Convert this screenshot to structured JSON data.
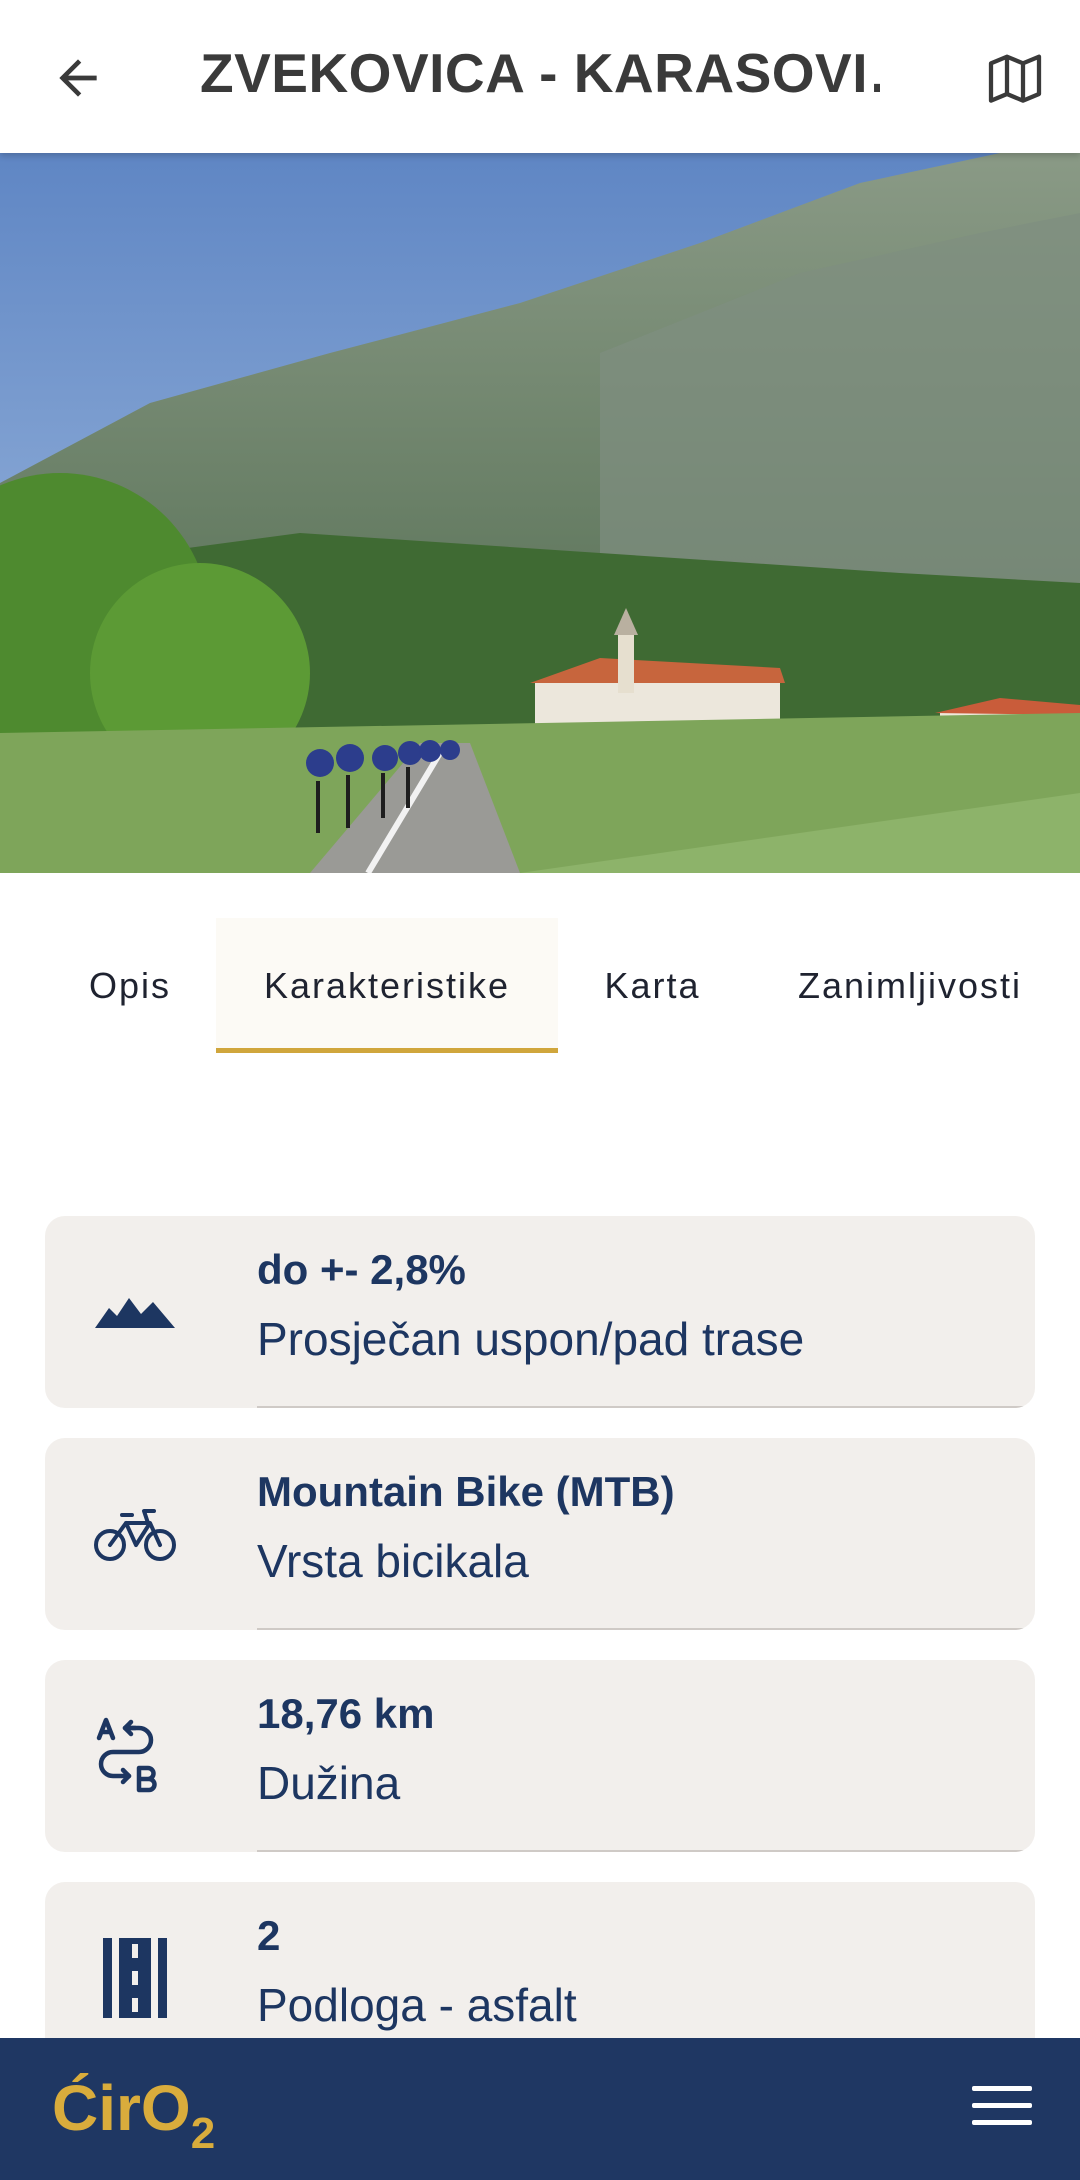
{
  "header": {
    "title": "ZVEKOVICA - KARASOVI…",
    "back_icon": "arrow-left-icon",
    "map_icon": "map-icon"
  },
  "tabs": [
    {
      "label": "Opis",
      "active": false
    },
    {
      "label": "Karakteristike",
      "active": true
    },
    {
      "label": "Karta",
      "active": false
    },
    {
      "label": "Zanimljivosti",
      "active": false
    }
  ],
  "characteristics": [
    {
      "icon": "mountains-icon",
      "value": "do +- 2,8%",
      "label": "Prosječan uspon/pad trase"
    },
    {
      "icon": "bicycle-icon",
      "value": "Mountain Bike (MTB)",
      "label": "Vrsta bicikala"
    },
    {
      "icon": "route-a-to-b-icon",
      "value": "18,76 km",
      "label": "Dužina"
    },
    {
      "icon": "road-icon",
      "value": "2",
      "label": "Podloga - asfalt"
    }
  ],
  "bottom_bar": {
    "logo_text": "ĆirO",
    "logo_subscript": "2",
    "menu_icon": "hamburger-menu-icon"
  },
  "colors": {
    "navy": "#1f3763",
    "gold": "#d0a63c",
    "card_bg": "#f2efec"
  }
}
